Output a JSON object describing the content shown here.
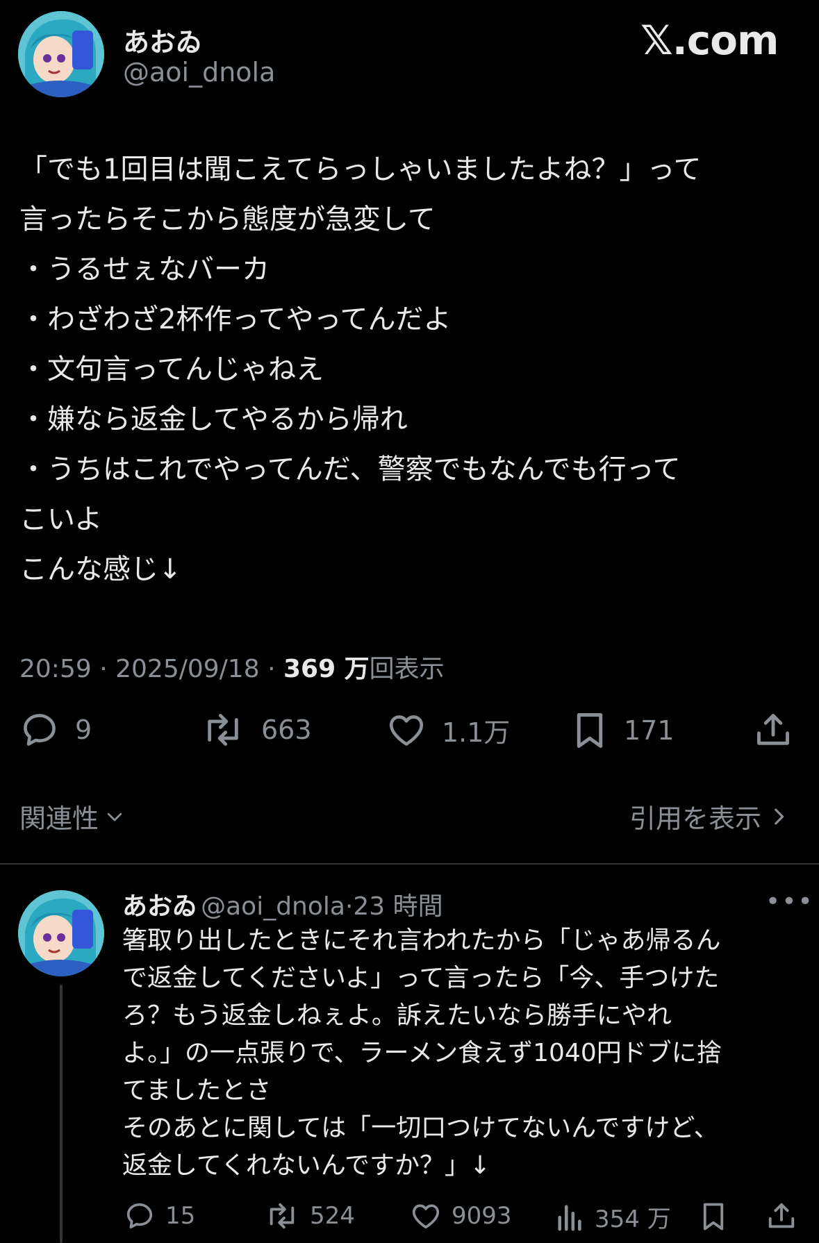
{
  "header": {
    "display_name": "あおゐ",
    "handle": "@aoi_dnola",
    "brand": "𝕏.com"
  },
  "tweet": {
    "lines": [
      "「でも1回目は聞こえてらっしゃいましたよね？」って",
      "言ったらそこから態度が急変して",
      "・うるせぇなバーカ",
      "・わざわざ2杯作ってやってんだよ",
      "・文句言ってんじゃねえ",
      "・嫌なら返金してやるから帰れ",
      "・うちはこれでやってんだ、警察でもなんでも行って",
      "こいよ",
      "こんな感じ↓"
    ],
    "time": "20:59",
    "date": "2025/09/18",
    "separator": "·",
    "views_num": "369 万",
    "views_label": "回表示"
  },
  "actions": {
    "replies": "9",
    "reposts": "663",
    "likes": "1.1万",
    "bookmarks": "171"
  },
  "sort": {
    "label": "関連性",
    "quotes_label": "引用を表示"
  },
  "reply": {
    "display_name": "あおゐ",
    "handle": "@aoi_dnola",
    "separator": "·",
    "time_ago": "23 時間",
    "more": "•••",
    "lines": [
      "箸取り出したときにそれ言われたから「じゃあ帰るん",
      "で返金してくださいよ」って言ったら「今、手つけた",
      "ろ？もう返金しねぇよ。訴えたいなら勝手にやれ",
      "よ。」の一点張りで、ラーメン食えず1040円ドブに捨",
      "てましたとさ",
      "そのあとに関しては「一切口つけてないんですけど、",
      "返金してくれないんですか？」↓"
    ],
    "actions": {
      "replies": "15",
      "reposts": "524",
      "likes": "9093",
      "views": "354 万"
    }
  },
  "colors": {
    "background": "#000000",
    "text": "#e7e9ea",
    "muted": "#8b9096",
    "divider": "#2f3336"
  }
}
